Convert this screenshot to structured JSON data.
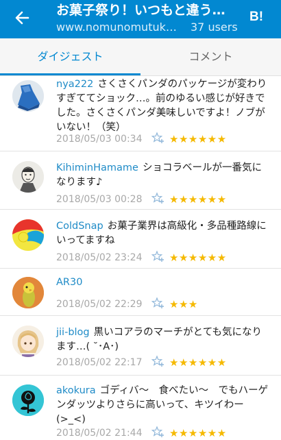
{
  "header": {
    "title": "お菓子祭り！いつもと違う…",
    "site": "www.nomunomutuk…",
    "users": "37 users",
    "hatena_logo": "B!"
  },
  "tabs": [
    {
      "label": "ダイジェスト",
      "active": true
    },
    {
      "label": "コメント",
      "active": false
    }
  ],
  "comments": [
    {
      "user": "nya222",
      "text": "さくさくパンダのパッケージが変わりすぎててショック…。前のゆるい感じが好きでした。さくさくパンダ美味しいですよ！ノブがいない！（笑）",
      "date": "2018/05/03 00:34",
      "stars": "★★★★★★",
      "star_count": 6,
      "avatar_icon": "blue-dress-photo-icon"
    },
    {
      "user": "KihiminHamame",
      "text": "ショコラベールが一番気になります♪",
      "date": "2018/05/03 00:28",
      "stars": "★★★★★★",
      "star_count": 6,
      "avatar_icon": "portrait-sketch-icon"
    },
    {
      "user": "ColdSnap",
      "text": "お菓子業界は高級化・多品種路線にいってますね",
      "date": "2018/05/02 23:24",
      "stars": "★★★★★★",
      "star_count": 6,
      "avatar_icon": "colorful-circle-icon"
    },
    {
      "user": "AR30",
      "text": "",
      "date": "2018/05/02 22:29",
      "stars": "★★★",
      "star_count": 3,
      "avatar_icon": "parakeet-icon"
    },
    {
      "user": "jii-blog",
      "text": "黒いコアラのマーチがとても気になります…( ˘･A･)",
      "date": "2018/05/02 22:17",
      "stars": "★★★★★★",
      "star_count": 6,
      "avatar_icon": "anime-girl-icon"
    },
    {
      "user": "akokura",
      "text": "ゴディバ～　食べたい～　でもハーゲンダッツよりさらに高いって、キツイわー(>_<)",
      "date": "2018/05/02 21:44",
      "stars": "★★★★★★",
      "star_count": 6,
      "avatar_icon": "black-rose-icon"
    }
  ],
  "colors": {
    "header_bg": "#0288d1",
    "accent": "#0288d1",
    "username": "#1f8bc7",
    "star": "#f5b900"
  }
}
